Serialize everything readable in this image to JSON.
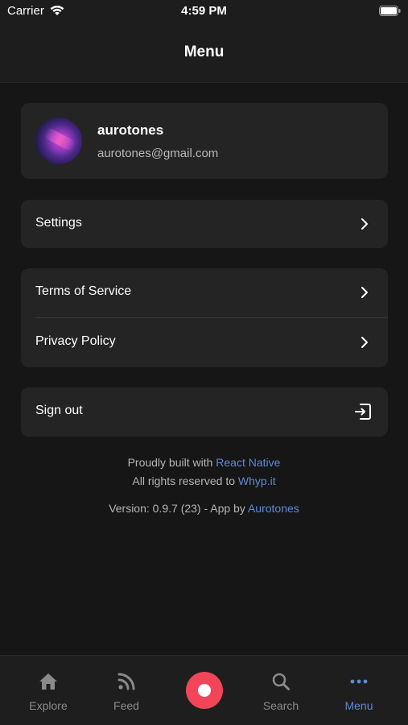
{
  "status_bar": {
    "carrier": "Carrier",
    "time": "4:59 PM"
  },
  "header": {
    "title": "Menu"
  },
  "profile": {
    "name": "aurotones",
    "email": "aurotones@gmail.com"
  },
  "menu": {
    "settings_label": "Settings",
    "terms_label": "Terms of Service",
    "privacy_label": "Privacy Policy",
    "signout_label": "Sign out"
  },
  "footer": {
    "built_prefix": "Proudly built with",
    "built_link": "React Native",
    "rights_prefix": "All rights reserved to",
    "rights_link": "Whyp.it",
    "version_text": "Version: 0.9.7 (23) - App by",
    "author_link": "Aurotones"
  },
  "tabs": {
    "explore": "Explore",
    "feed": "Feed",
    "search": "Search",
    "menu": "Menu"
  },
  "colors": {
    "accent": "#5d8ad6",
    "record": "#f2455a",
    "background": "#161616",
    "card": "#242424"
  }
}
